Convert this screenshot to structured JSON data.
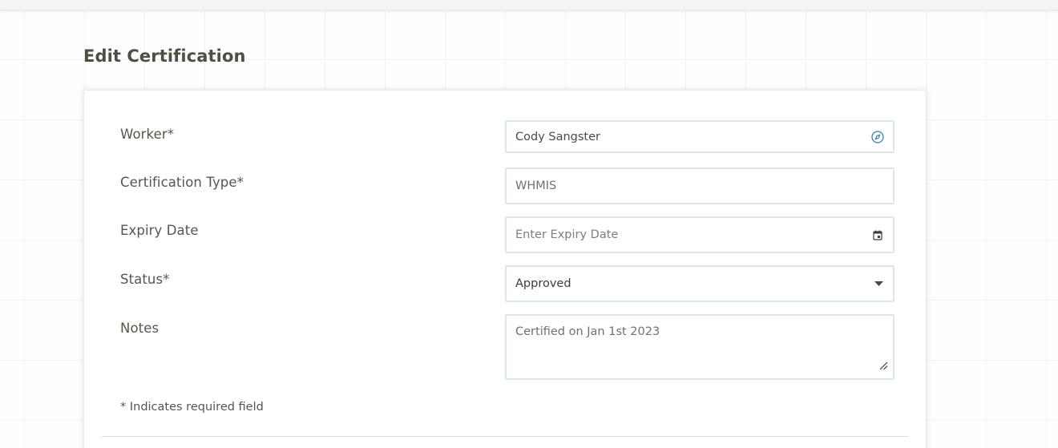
{
  "page": {
    "title": "Edit Certification"
  },
  "form": {
    "worker": {
      "label": "Worker*",
      "value": "Cody Sangster",
      "icon": "compass-icon"
    },
    "certification_type": {
      "label": "Certification Type*",
      "value": "WHMIS"
    },
    "expiry_date": {
      "label": "Expiry Date",
      "placeholder": "Enter Expiry Date",
      "icon": "calendar-icon"
    },
    "status": {
      "label": "Status*",
      "value": "Approved",
      "icon": "caret-down-icon"
    },
    "notes": {
      "label": "Notes",
      "value": "Certified on Jan 1st 2023"
    },
    "required_note": "* Indicates required field"
  },
  "colors": {
    "accent": "#3d7fa8",
    "label_text": "#55564a",
    "field_border": "#dde8e6"
  }
}
